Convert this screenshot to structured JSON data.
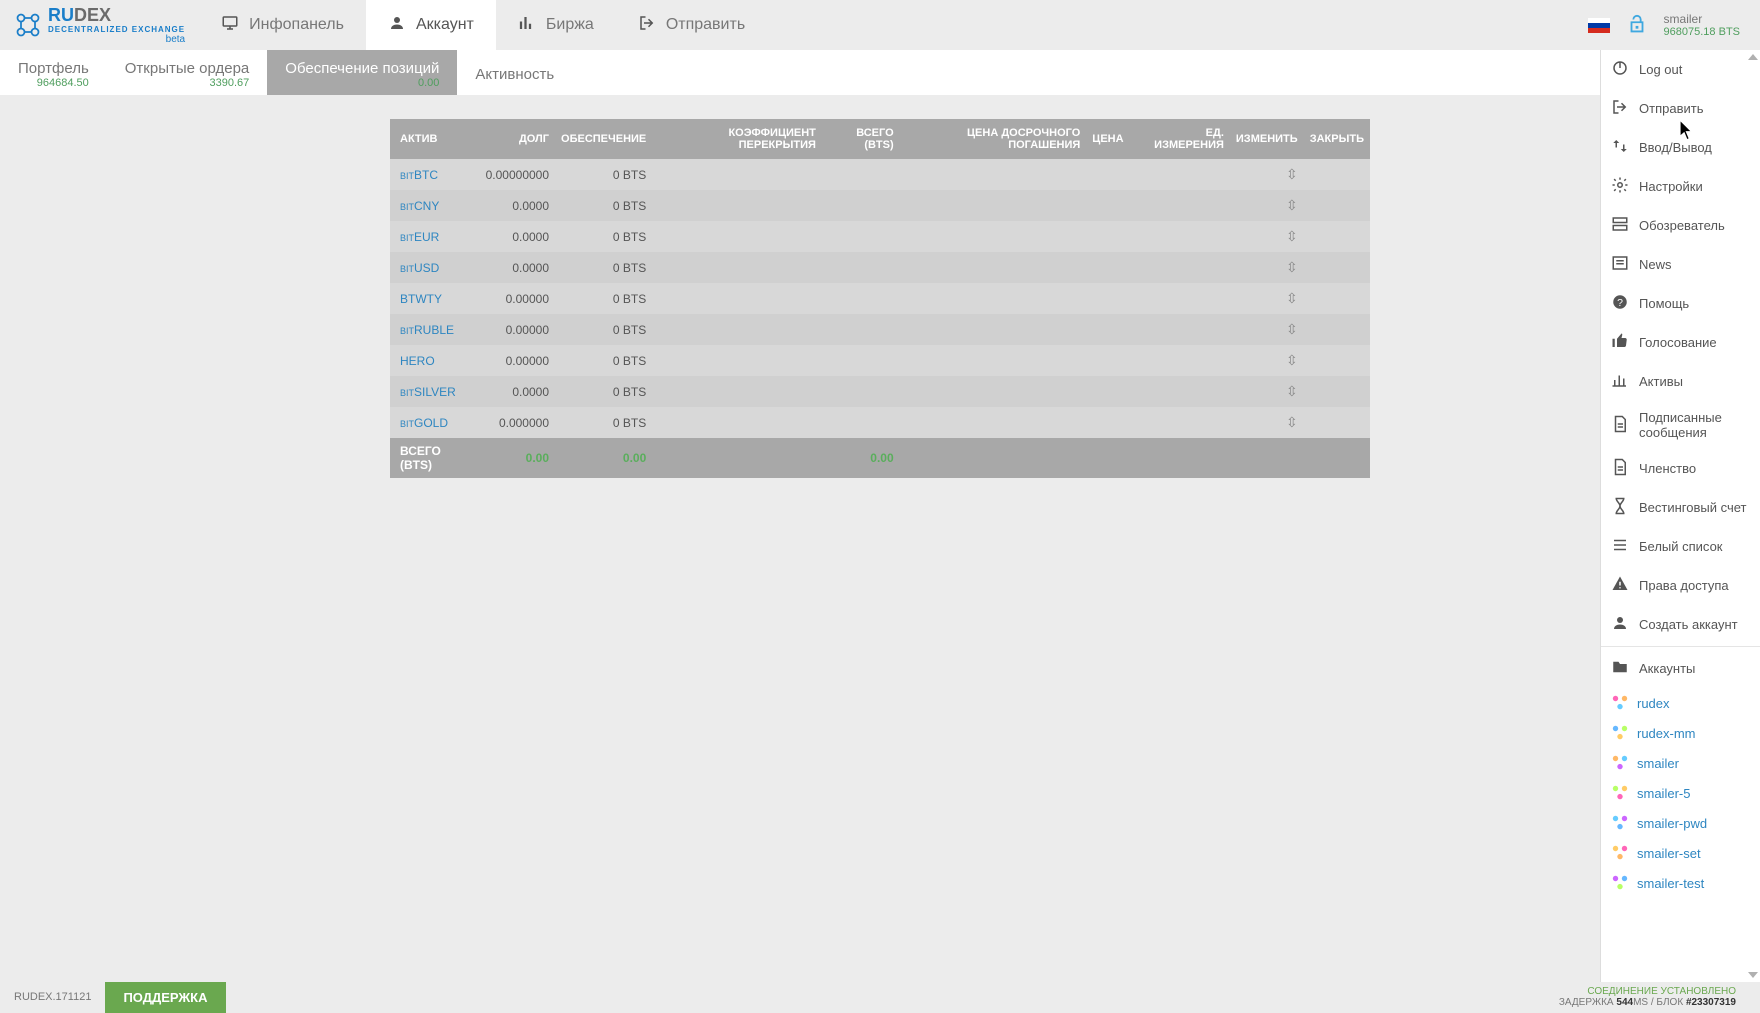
{
  "header": {
    "logo": {
      "ru": "RU",
      "dex": "DEX",
      "sub": "DECENTRALIZED EXCHANGE",
      "beta": "beta"
    },
    "tabs": [
      {
        "label": "Инфопанель",
        "icon": "monitor"
      },
      {
        "label": "Аккаунт",
        "icon": "person",
        "active": true
      },
      {
        "label": "Биржа",
        "icon": "chart"
      },
      {
        "label": "Отправить",
        "icon": "logout"
      }
    ],
    "account": {
      "name": "smailer",
      "balance": "968075.18 BTS"
    }
  },
  "subtabs": [
    {
      "label": "Портфель",
      "val": "964684.50"
    },
    {
      "label": "Открытые ордера",
      "val": "3390.67"
    },
    {
      "label": "Обеспечение позиций",
      "val": "0.00",
      "active": true
    },
    {
      "label": "Активность"
    }
  ],
  "table": {
    "headers": [
      "АКТИВ",
      "ДОЛГ",
      "ОБЕСПЕЧЕНИЕ",
      "КОЭФФИЦИЕНТ ПЕРЕКРЫТИЯ",
      "ВСЕГО (BTS)",
      "ЦЕНА ДОСРОЧНОГО ПОГАШЕНИЯ",
      "ЦЕНА",
      "ЕД. ИЗМЕРЕНИЯ",
      "ИЗМЕНИТЬ",
      "ЗАКРЫТЬ"
    ],
    "rows": [
      {
        "prefix": "BIT",
        "name": "BTC",
        "debt": "0.00000000",
        "coll": "0 BTS"
      },
      {
        "prefix": "BIT",
        "name": "CNY",
        "debt": "0.0000",
        "coll": "0 BTS"
      },
      {
        "prefix": "BIT",
        "name": "EUR",
        "debt": "0.0000",
        "coll": "0 BTS"
      },
      {
        "prefix": "BIT",
        "name": "USD",
        "debt": "0.0000",
        "coll": "0 BTS"
      },
      {
        "prefix": "",
        "name": "BTWTY",
        "debt": "0.00000",
        "coll": "0 BTS"
      },
      {
        "prefix": "BIT",
        "name": "RUBLE",
        "debt": "0.00000",
        "coll": "0 BTS"
      },
      {
        "prefix": "",
        "name": "HERO",
        "debt": "0.00000",
        "coll": "0 BTS"
      },
      {
        "prefix": "BIT",
        "name": "SILVER",
        "debt": "0.0000",
        "coll": "0 BTS"
      },
      {
        "prefix": "BIT",
        "name": "GOLD",
        "debt": "0.000000",
        "coll": "0 BTS"
      }
    ],
    "footer": {
      "label": "ВСЕГО (BTS)",
      "debt": "0.00",
      "coll": "0.00",
      "total": "0.00"
    }
  },
  "sidebar": {
    "items": [
      {
        "label": "Log out",
        "icon": "power"
      },
      {
        "label": "Отправить",
        "icon": "logout"
      },
      {
        "label": "Ввод/Вывод",
        "icon": "swap"
      },
      {
        "label": "Настройки",
        "icon": "gear"
      },
      {
        "label": "Обозреватель",
        "icon": "server"
      },
      {
        "label": "News",
        "icon": "news"
      },
      {
        "label": "Помощь",
        "icon": "help"
      },
      {
        "label": "Голосование",
        "icon": "thumb"
      },
      {
        "label": "Активы",
        "icon": "barchart"
      },
      {
        "label": "Подписанные сообщения",
        "icon": "doc"
      },
      {
        "label": "Членство",
        "icon": "doc"
      },
      {
        "label": "Вестинговый счет",
        "icon": "hourglass"
      },
      {
        "label": "Белый список",
        "icon": "list"
      },
      {
        "label": "Права доступа",
        "icon": "warn"
      },
      {
        "label": "Создать аккаунт",
        "icon": "person"
      },
      {
        "label": "Аккаунты",
        "icon": "folder"
      }
    ],
    "accounts": [
      "rudex",
      "rudex-mm",
      "smailer",
      "smailer-5",
      "smailer-pwd",
      "smailer-set",
      "smailer-test"
    ]
  },
  "footer": {
    "version": "RUDEX.171121",
    "support": "ПОДДЕРЖКА",
    "connection": "СОЕДИНЕНИЕ УСТАНОВЛЕНО",
    "latency_label": "ЗАДЕРЖКА",
    "latency_val": "544",
    "latency_unit": "MS",
    "block_label": "БЛОК",
    "block_val": "#23307319"
  }
}
